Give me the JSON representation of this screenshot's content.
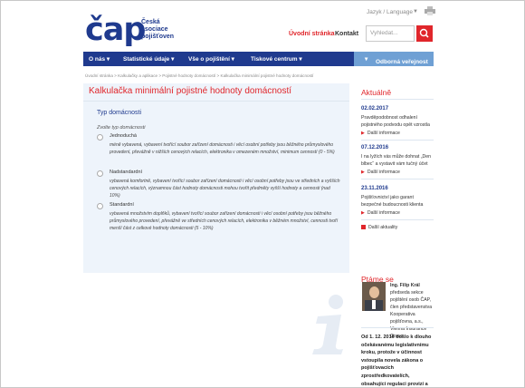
{
  "brand": {
    "mark": "čap",
    "line1": "Česká",
    "line2": "asociace",
    "line3": "pojišťoven",
    "accent": "#e0262b",
    "primary": "#1f3a8e"
  },
  "header": {
    "language_label": "Jazyk / Language",
    "home_link": "Úvodní stránka",
    "contact_link": "Kontakt",
    "search_placeholder": "Vyhledat..."
  },
  "mainnav": {
    "items": [
      "O nás",
      "Statistické údaje",
      "Vše o pojištění",
      "Tiskové centrum"
    ],
    "public_label": "Odborná veřejnost"
  },
  "breadcrumb": "Úvodní stránka  >  Kalkulačky a aplikace  >  Pojistné hodnoty domácností  >  Kalkulačka minimální pojistné hodnoty domácností",
  "main": {
    "title": "Kalkulačka minimální pojistné hodnoty domácností",
    "section_title": "Typ domácnosti",
    "hint": "Zvolte typ domácnosti",
    "options": [
      {
        "label": "Jednoduchá",
        "desc": "méně vybavená, vybavení tvořící soubor zařízení domácnosti i věcí osobní potřeby jsou běžného průmyslového provedení, převážně v nižších cenových relacích, elektronika v omezeném množství, minimum cenností (0 - 5%)"
      },
      {
        "label": "Nadstandardní",
        "desc": "vybavená komfortně, vybavení tvořící soubor zařízení domácnosti i věcí osobní potřeby jsou ve středních a vyšších cenových relacích, významnou část hodnoty domácnosti mohou tvořit předměty vyšší hodnoty a cennosti (nad 10%)"
      },
      {
        "label": "Standardní",
        "desc": "vybavená množstvím doplňků, vybavení tvořící soubor zařízení domácnosti i věcí osobní potřeby jsou běžného průmyslového provedení, převážně ve středních cenových relacích, elektronika v běžném množství, cennosti tvoří menší část z celkové hodnoty domácnosti (5 - 10%)"
      }
    ]
  },
  "sidebar": {
    "news_heading": "Aktuálně",
    "news": [
      {
        "date": "02.02.2017",
        "text": "Pravděpodobnost odhalení pojistného podvodu opět vzrostla",
        "link": "Další informace"
      },
      {
        "date": "07.12.2016",
        "text": "I na lyžích vás může dohnat „Den blbec“ a vystavit vám tučný účet",
        "link": "Další informace"
      },
      {
        "date": "23.11.2016",
        "text": "Pojišťovnictví jako garant bezpečné budoucnosti klienta",
        "link": "Další informace"
      }
    ],
    "all_news": "Další aktuality",
    "ask_heading": "Ptáme se",
    "person": {
      "name": "Ing. Filip Král",
      "role": "předseda sekce pojištění osob ČAP, člen představenstva Kooperativa pojišťovna, a.s., Vienna Insurance Group"
    },
    "teaser": "Od 1. 12. 2016 došlo k dlouho očekávanému legislativnímu kroku, protože v účinnost vstoupila novela zákona o pojišťovacích zprostředkovatelích, obsahující regulaci provizí a"
  }
}
